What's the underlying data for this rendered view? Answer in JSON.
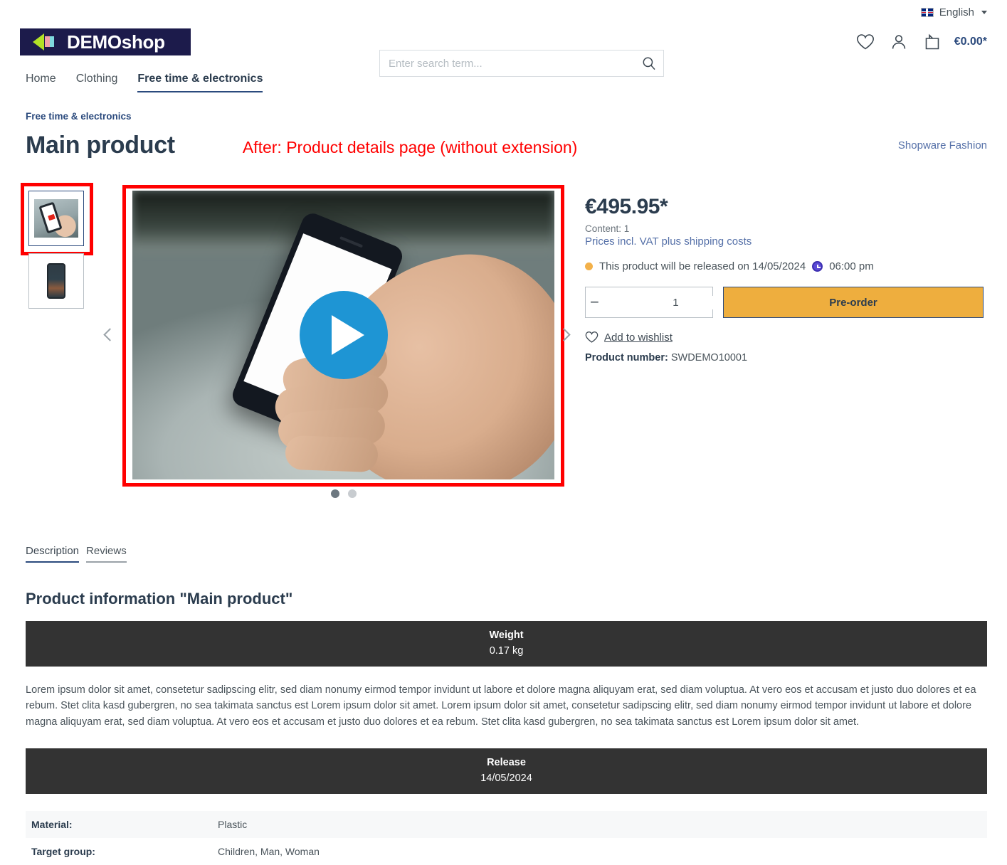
{
  "topbar": {
    "language": "English",
    "flag_icon": "uk-flag-icon"
  },
  "header": {
    "logo_text": "DEMOshop",
    "search": {
      "placeholder": "Enter search term...",
      "value": ""
    },
    "cart_total": "€0.00*"
  },
  "nav": {
    "items": [
      {
        "label": "Home",
        "active": false
      },
      {
        "label": "Clothing",
        "active": false
      },
      {
        "label": "Free time & electronics",
        "active": true
      }
    ]
  },
  "breadcrumb": "Free time & electronics",
  "product": {
    "title": "Main product",
    "annotation": "After: Product details page (without extension)",
    "manufacturer": "Shopware Fashion",
    "price": "€495.95*",
    "content_line": "Content: 1",
    "vat_line": "Prices incl. VAT plus shipping costs",
    "release_notice": "This product will be released on 14/05/2024",
    "release_time": "06:00 pm",
    "quantity": "1",
    "decrease_label": "−",
    "increase_label": "+",
    "preorder_label": "Pre-order",
    "wishlist_label": "Add to wishlist",
    "product_number_label": "Product number:",
    "product_number": "SWDEMO10001"
  },
  "gallery": {
    "thumbnails": [
      {
        "name": "thumbnail-video-preview",
        "active": true
      },
      {
        "name": "thumbnail-phone",
        "active": false
      }
    ],
    "dots": [
      {
        "active": true
      },
      {
        "active": false
      }
    ],
    "play_label": "play-button"
  },
  "tabs": [
    {
      "label": "Description",
      "active": true
    },
    {
      "label": "Reviews",
      "active": false
    }
  ],
  "description": {
    "heading": "Product information \"Main product\"",
    "weight_table": {
      "header": "Weight",
      "value": "0.17 kg"
    },
    "body": "Lorem ipsum dolor sit amet, consetetur sadipscing elitr, sed diam nonumy eirmod tempor invidunt ut labore et dolore magna aliquyam erat, sed diam voluptua. At vero eos et accusam et justo duo dolores et ea rebum. Stet clita kasd gubergren, no sea takimata sanctus est Lorem ipsum dolor sit amet. Lorem ipsum dolor sit amet, consetetur sadipscing elitr, sed diam nonumy eirmod tempor invidunt ut labore et dolore magna aliquyam erat, sed diam voluptua. At vero eos et accusam et justo duo dolores et ea rebum. Stet clita kasd gubergren, no sea takimata sanctus est Lorem ipsum dolor sit amet.",
    "release_table": {
      "header": "Release",
      "value": "14/05/2024"
    },
    "properties": [
      {
        "label": "Material:",
        "value": "Plastic"
      },
      {
        "label": "Target group:",
        "value": "Children, Man, Woman"
      }
    ]
  },
  "colors": {
    "brand_blue": "#2b4a7d",
    "link_blue": "#5570a8",
    "accent_amber": "#eeae3e",
    "annotation_red": "#ff0000",
    "table_dark": "#333333",
    "status_orange": "#f3b14a"
  }
}
